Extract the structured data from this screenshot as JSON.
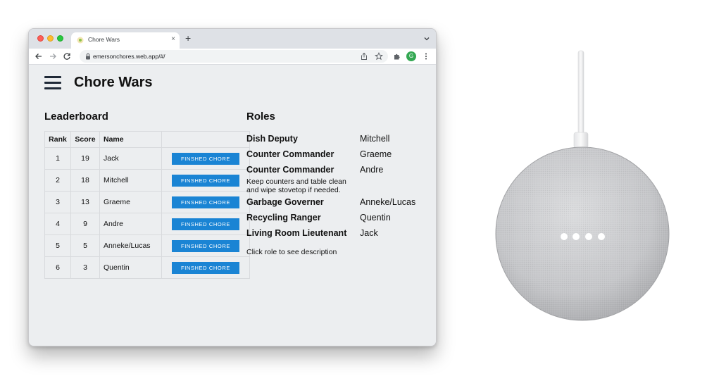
{
  "browser": {
    "tab_title": "Chore Wars",
    "tab_close": "×",
    "new_tab": "+",
    "url": "emersonchores.web.app/#/",
    "profile_initial": "G"
  },
  "app": {
    "title": "Chore Wars"
  },
  "leaderboard": {
    "title": "Leaderboard",
    "columns": [
      "Rank",
      "Score",
      "Name",
      ""
    ],
    "button_label": "FINSHED CHORE",
    "rows": [
      {
        "rank": "1",
        "score": "19",
        "name": "Jack"
      },
      {
        "rank": "2",
        "score": "18",
        "name": "Mitchell"
      },
      {
        "rank": "3",
        "score": "13",
        "name": "Graeme"
      },
      {
        "rank": "4",
        "score": "9",
        "name": "Andre"
      },
      {
        "rank": "5",
        "score": "5",
        "name": "Anneke/Lucas"
      },
      {
        "rank": "6",
        "score": "3",
        "name": "Quentin"
      }
    ]
  },
  "roles": {
    "title": "Roles",
    "items": [
      {
        "role": "Dish Deputy",
        "person": "Mitchell",
        "description": ""
      },
      {
        "role": "Counter Commander",
        "person": "Graeme",
        "description": ""
      },
      {
        "role": "Counter Commander",
        "person": "Andre",
        "description": "Keep counters and table clean and wipe stovetop if needed."
      },
      {
        "role": "Garbage Governer",
        "person": "Anneke/Lucas",
        "description": ""
      },
      {
        "role": "Recycling Ranger",
        "person": "Quentin",
        "description": ""
      },
      {
        "role": "Living Room Lieutenant",
        "person": "Jack",
        "description": ""
      }
    ],
    "hint": "Click role to see description"
  },
  "colors": {
    "button_blue": "#1a84d4",
    "page_bg": "#eceef0",
    "speaker_fabric": "#c9cacd"
  },
  "icons": [
    "back-arrow-icon",
    "forward-arrow-icon",
    "reload-icon",
    "lock-icon",
    "share-icon",
    "star-icon",
    "extensions-icon",
    "kebab-menu-icon",
    "hamburger-menu-icon",
    "chevron-down-icon"
  ]
}
